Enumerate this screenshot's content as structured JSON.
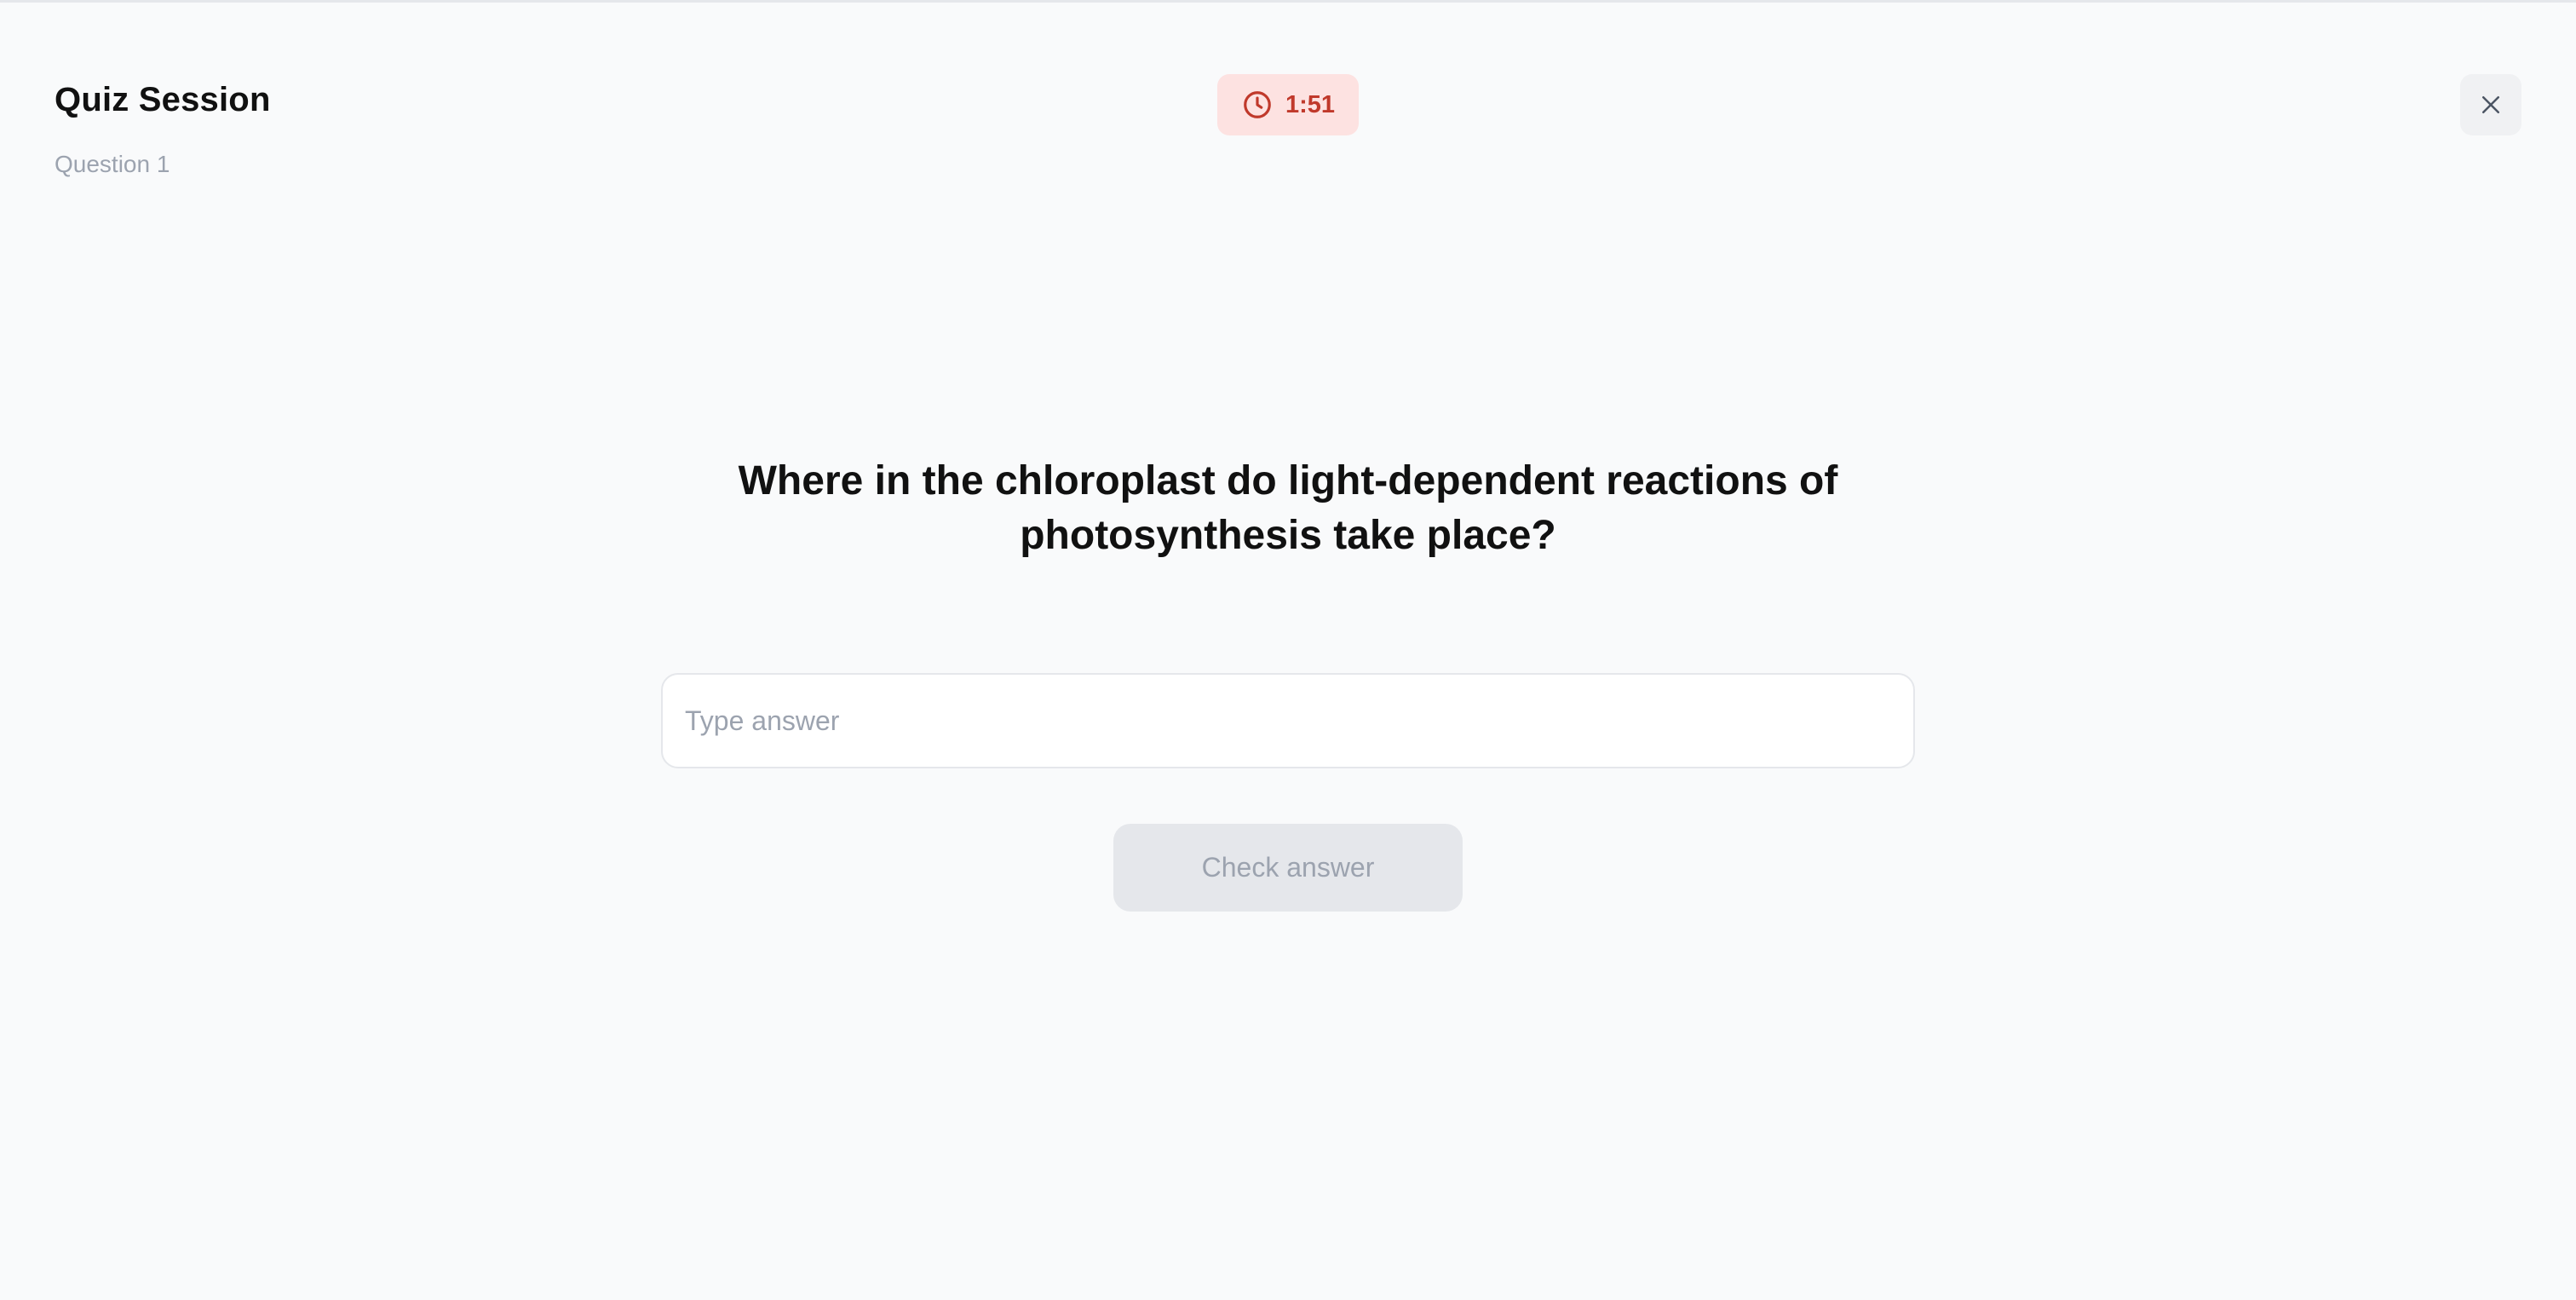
{
  "header": {
    "title": "Quiz Session",
    "subtitle": "Question 1"
  },
  "timer": {
    "icon": "clock-icon",
    "value": "1:51",
    "color": "#c0392b",
    "background": "#fde2e1"
  },
  "close_button": {
    "icon": "close-icon"
  },
  "question": {
    "text": "Where in the chloroplast do light-dependent reactions of photosynthesis take place?"
  },
  "answer": {
    "value": "",
    "placeholder": "Type answer"
  },
  "check_button": {
    "label": "Check answer",
    "disabled": true
  }
}
